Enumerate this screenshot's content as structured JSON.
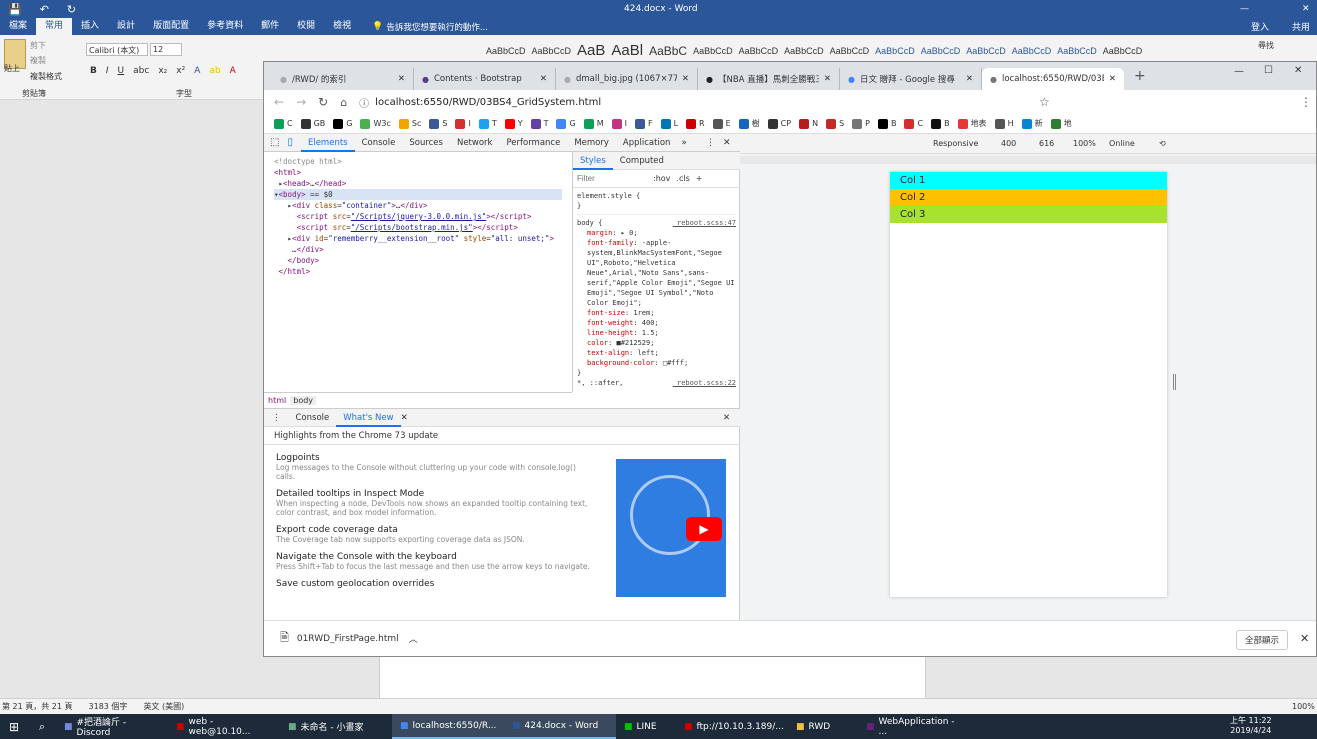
{
  "word": {
    "title": "424.docx - Word",
    "tabs": [
      "檔案",
      "常用",
      "插入",
      "設計",
      "版面配置",
      "參考資料",
      "郵件",
      "校閱",
      "檢視"
    ],
    "tell_me": "告訴我您想要執行的動作...",
    "signin": "登入",
    "share": "共用",
    "clipboard": {
      "paste": "貼上",
      "cut": "剪下",
      "copy": "複製",
      "format_painter": "複製格式",
      "group": "剪貼簿"
    },
    "font": {
      "name": "Calibri (本文)",
      "size": "12",
      "group": "字型"
    },
    "styles": [
      "AaBbCcD",
      "AaBbCcD",
      "AaB",
      "AaBl",
      "AaBbC",
      "AaBbCcD",
      "AaBbCcD",
      "AaBbCcD",
      "AaBbCcD",
      "AaBbCcD",
      "AaBbCcD",
      "AaBbCcD",
      "AaBbCcD",
      "AaBbCcD",
      "AaBbCcD"
    ],
    "find": "尋找",
    "status": {
      "page": "第 21 頁，共 21 頁",
      "words": "3183 個字",
      "lang": "英文 (美國)",
      "zoom": "100%"
    }
  },
  "chrome": {
    "tabs": [
      {
        "label": "/RWD/ 的索引"
      },
      {
        "label": "Contents · Bootstrap"
      },
      {
        "label": "dmall_big.jpg (1067×772)"
      },
      {
        "label": "【NBA 直播】馬刺全勝戰三..."
      },
      {
        "label": "日文 贈拜 - Google 搜尋"
      },
      {
        "label": "localhost:6550/RWD/03B..."
      }
    ],
    "url": "localhost:6550/RWD/03BS4_GridSystem.html",
    "bookmarks": [
      {
        "label": "C",
        "color": "#0f9d58"
      },
      {
        "label": "GB",
        "color": "#333"
      },
      {
        "label": "G",
        "color": "#000"
      },
      {
        "label": "W3c",
        "color": "#4caf50"
      },
      {
        "label": "Sc",
        "color": "#f0a500"
      },
      {
        "label": "S",
        "color": "#3b5998"
      },
      {
        "label": "I",
        "color": "#d32f2f"
      },
      {
        "label": "T",
        "color": "#1da1f2"
      },
      {
        "label": "Y",
        "color": "#ff0000"
      },
      {
        "label": "T",
        "color": "#6441a5"
      },
      {
        "label": "G",
        "color": "#4285f4"
      },
      {
        "label": "M",
        "color": "#0f9d58"
      },
      {
        "label": "I",
        "color": "#c13584"
      },
      {
        "label": "F",
        "color": "#3b5998"
      },
      {
        "label": "L",
        "color": "#0077b5"
      },
      {
        "label": "R",
        "color": "#cc0000"
      },
      {
        "label": "E",
        "color": "#555"
      },
      {
        "label": "樹",
        "color": "#1565c0"
      },
      {
        "label": "CP",
        "color": "#333"
      },
      {
        "label": "N",
        "color": "#b71c1c"
      },
      {
        "label": "S",
        "color": "#c62828"
      },
      {
        "label": "P",
        "color": "#777"
      },
      {
        "label": "B",
        "color": "#000"
      },
      {
        "label": "C",
        "color": "#d32f2f"
      },
      {
        "label": "B",
        "color": "#111"
      },
      {
        "label": "地表",
        "color": "#e53935"
      },
      {
        "label": "H",
        "color": "#555"
      },
      {
        "label": "新",
        "color": "#0288d1"
      },
      {
        "label": "地",
        "color": "#2e7d32"
      }
    ],
    "download": "01RWD_FirstPage.html",
    "show_all": "全部顯示"
  },
  "devtools": {
    "tabs": [
      "Elements",
      "Console",
      "Sources",
      "Network",
      "Performance",
      "Memory",
      "Application"
    ],
    "styles_tabs": [
      "Styles",
      "Computed"
    ],
    "filter_placeholder": "Filter",
    "hov": ":hov",
    "cls": ".cls",
    "element_style": "element.style {",
    "body_rule": "body {",
    "reboot_link": "_reboot.scss:47",
    "reboot_link2": "_reboot.scss:22",
    "crumbs": [
      "html",
      "body"
    ],
    "drawer_tabs": [
      "Console",
      "What's New"
    ],
    "highlights": "Highlights from the Chrome 73 update",
    "news": [
      {
        "title": "Logpoints",
        "desc": "Log messages to the Console without cluttering up your code with console.log() calls."
      },
      {
        "title": "Detailed tooltips in Inspect Mode",
        "desc": "When inspecting a node, DevTools now shows an expanded tooltip containing text, color contrast, and box model information."
      },
      {
        "title": "Export code coverage data",
        "desc": "The Coverage tab now supports exporting coverage data as JSON."
      },
      {
        "title": "Navigate the Console with the keyboard",
        "desc": "Press Shift+Tab to focus the last message and then use the arrow keys to navigate."
      },
      {
        "title": "Save custom geolocation overrides",
        "desc": ""
      }
    ]
  },
  "device": {
    "mode": "Responsive",
    "width": "400",
    "height": "616",
    "zoom": "100%",
    "network": "Online"
  },
  "page": {
    "cols": [
      {
        "label": "Col 1",
        "color": "#00ffff"
      },
      {
        "label": "Col 2",
        "color": "#ffc000"
      },
      {
        "label": "Col 3",
        "color": "#a6e22e"
      }
    ]
  },
  "taskbar": {
    "items": [
      "#把酒論斤 - Discord",
      "web - web@10.10...",
      "未命名 - 小畫家",
      "localhost:6550/R...",
      "424.docx - Word",
      "LINE",
      "ftp://10.10.3.189/...",
      "RWD",
      "WebApplication - ..."
    ],
    "time": "上午 11:22",
    "date": "2019/4/24"
  }
}
